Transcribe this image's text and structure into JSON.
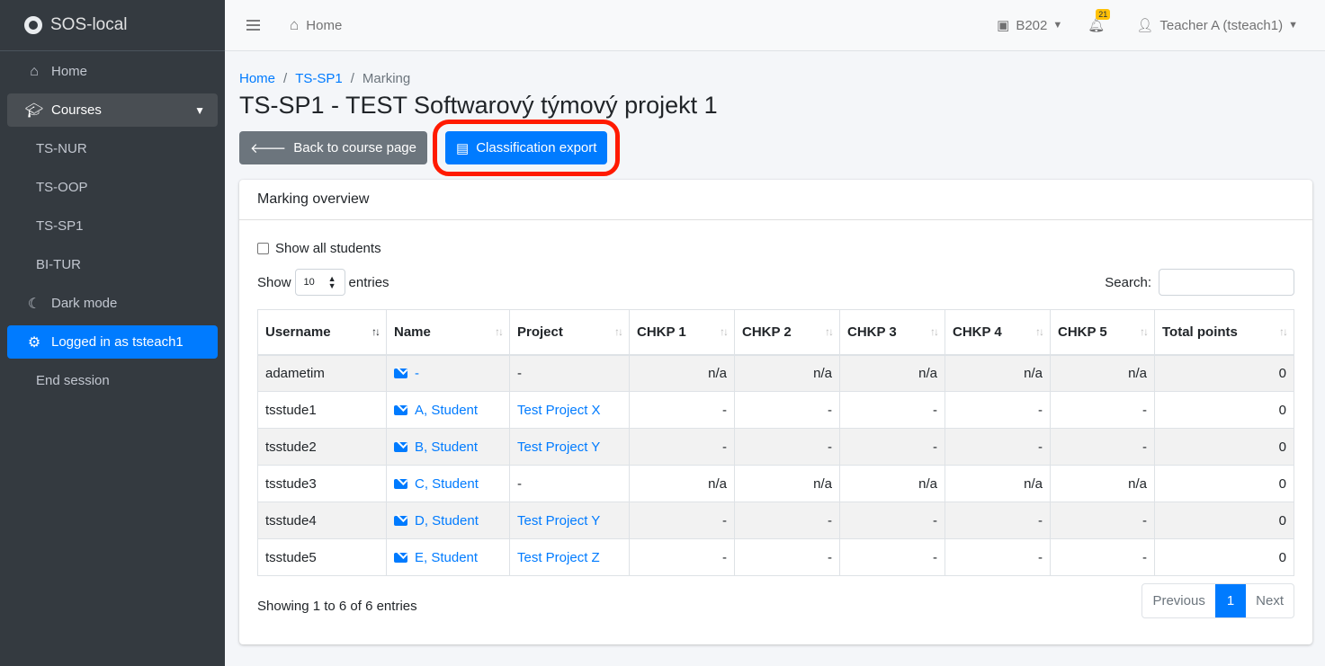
{
  "sidebar": {
    "brand": "SOS-local",
    "items": [
      {
        "label": "Home",
        "icon": "home-icon"
      },
      {
        "label": "Courses",
        "icon": "graduation-cap-icon"
      },
      {
        "label": "TS-NUR"
      },
      {
        "label": "TS-OOP"
      },
      {
        "label": "TS-SP1"
      },
      {
        "label": "BI-TUR"
      },
      {
        "label": "Dark mode",
        "icon": "moon-icon"
      },
      {
        "label": "Logged in as tsteach1",
        "icon": "user-cog-icon"
      },
      {
        "label": "End session"
      }
    ]
  },
  "topbar": {
    "home": "Home",
    "room": "B202",
    "notifications": "21",
    "user": "Teacher A (tsteach1)"
  },
  "breadcrumb": {
    "home": "Home",
    "course": "TS-SP1",
    "current": "Marking"
  },
  "page_title": "TS-SP1 - TEST Softwarový týmový projekt 1",
  "buttons": {
    "back": "Back to course page",
    "export": "Classification export"
  },
  "card": {
    "header": "Marking overview",
    "show_all": "Show all students",
    "show": "Show",
    "length_value": "10",
    "entries": "entries",
    "search": "Search:",
    "columns": [
      "Username",
      "Name",
      "Project",
      "CHKP 1",
      "CHKP 2",
      "CHKP 3",
      "CHKP 4",
      "CHKP 5",
      "Total points"
    ],
    "rows": [
      {
        "username": "adametim",
        "name": "-",
        "project": "-",
        "project_link": false,
        "c1": "n/a",
        "c2": "n/a",
        "c3": "n/a",
        "c4": "n/a",
        "c5": "n/a",
        "total": "0"
      },
      {
        "username": "tsstude1",
        "name": "A, Student",
        "project": "Test Project X",
        "project_link": true,
        "c1": "-",
        "c2": "-",
        "c3": "-",
        "c4": "-",
        "c5": "-",
        "total": "0"
      },
      {
        "username": "tsstude2",
        "name": "B, Student",
        "project": "Test Project Y",
        "project_link": true,
        "c1": "-",
        "c2": "-",
        "c3": "-",
        "c4": "-",
        "c5": "-",
        "total": "0"
      },
      {
        "username": "tsstude3",
        "name": "C, Student",
        "project": "-",
        "project_link": false,
        "c1": "n/a",
        "c2": "n/a",
        "c3": "n/a",
        "c4": "n/a",
        "c5": "n/a",
        "total": "0"
      },
      {
        "username": "tsstude4",
        "name": "D, Student",
        "project": "Test Project Y",
        "project_link": true,
        "c1": "-",
        "c2": "-",
        "c3": "-",
        "c4": "-",
        "c5": "-",
        "total": "0"
      },
      {
        "username": "tsstude5",
        "name": "E, Student",
        "project": "Test Project Z",
        "project_link": true,
        "c1": "-",
        "c2": "-",
        "c3": "-",
        "c4": "-",
        "c5": "-",
        "total": "0"
      }
    ],
    "info": "Showing 1 to 6 of 6 entries",
    "pager": {
      "prev": "Previous",
      "page": "1",
      "next": "Next"
    }
  }
}
